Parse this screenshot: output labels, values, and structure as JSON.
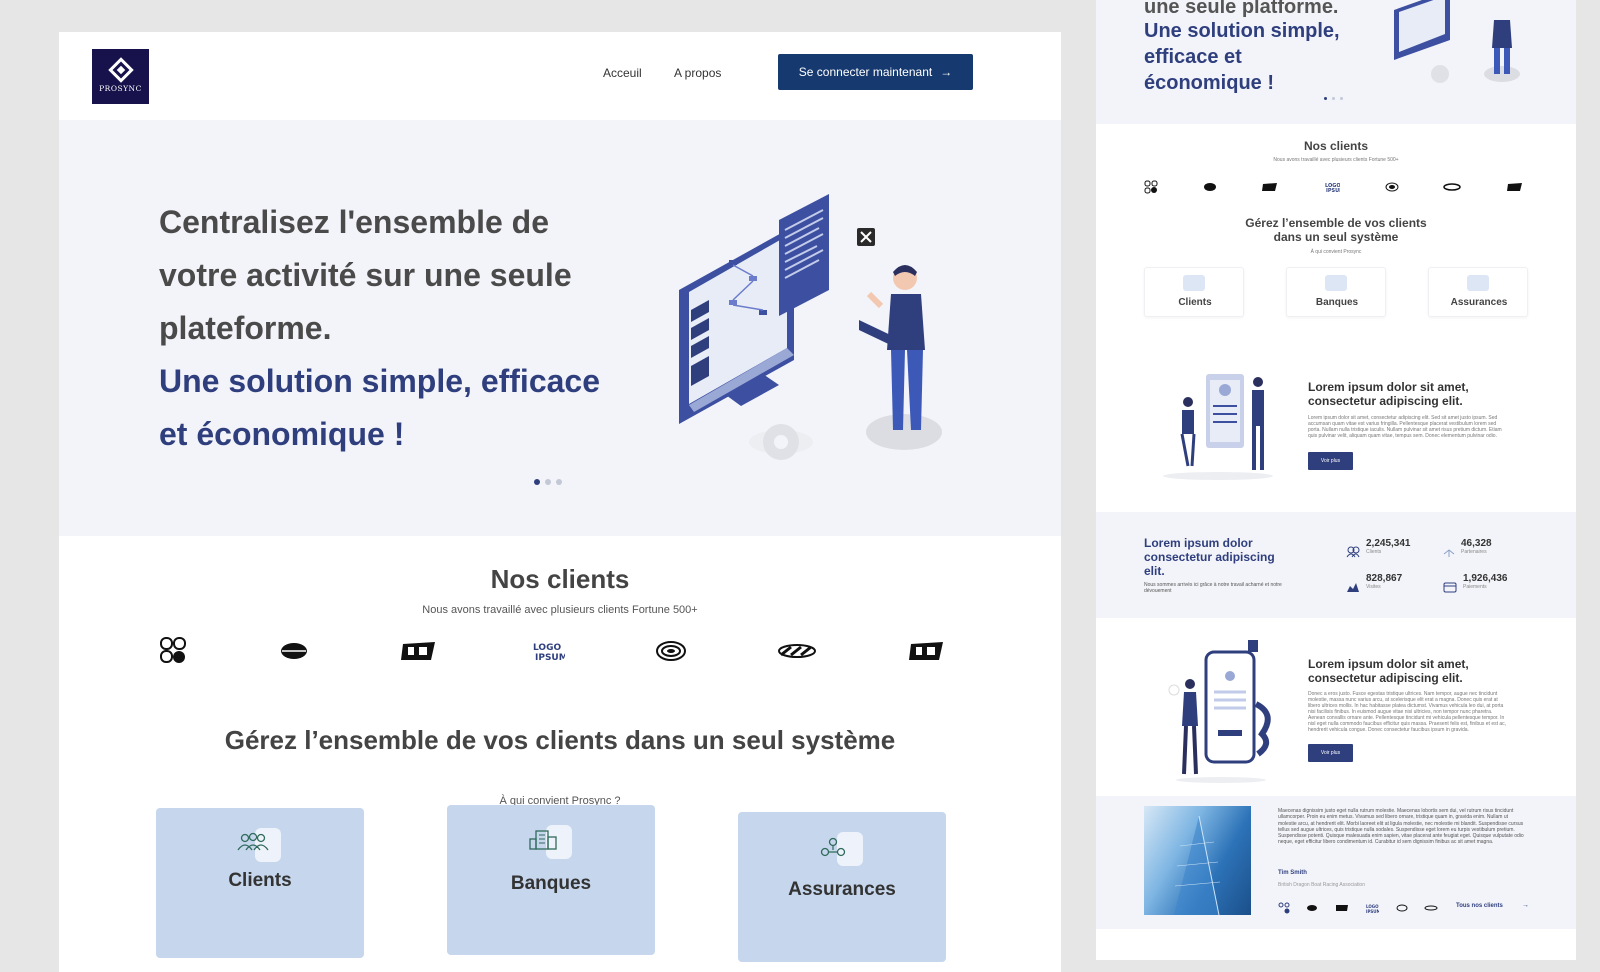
{
  "brand": {
    "logo_text": "PROSYNC"
  },
  "nav": {
    "home": "Acceuil",
    "about": "A propos",
    "cta": "Se connecter maintenant",
    "cta_arrow": "→"
  },
  "hero": {
    "line1": "Centralisez l'ensemble de votre activité sur une seule plateforme.",
    "line2": "Une solution simple, efficace et économique !",
    "slides_total": 3,
    "slide_active": 1
  },
  "clients": {
    "title": "Nos clients",
    "subtitle": "Nous avons travaillé avec plusieurs clients Fortune 500+"
  },
  "manage": {
    "title": "Gérez l’ensemble de vos clients dans un seul système",
    "subtitle": "À qui convient Prosync ?"
  },
  "cards": [
    {
      "label": "Clients",
      "icon": "people-icon"
    },
    {
      "label": "Banques",
      "icon": "bank-icon"
    },
    {
      "label": "Assurances",
      "icon": "insurance-icon"
    }
  ],
  "side": {
    "hero_top": "une seule platforme.",
    "hero_text": "Une solution simple, efficace et économique !",
    "clients_title": "Nos clients",
    "clients_subtitle": "Nous avons travaillé avec plusieurs clients Fortune 500+",
    "manage_title": "Gérez l’ensemble de vos clients dans un seul système",
    "manage_subtitle": "À qui convient Prosync",
    "feature1": {
      "title": "Lorem ipsum dolor sit amet, consectetur adipiscing elit.",
      "body": "Lorem ipsum dolor sit amet, consectetur adipiscing elit. Sed sit amet justo ipsum. Sed accumsan quam vitae est varius fringilla. Pellentesque placerat vestibulum lorem sed porta. Nullam nulla tristique iaculis. Nullam pulvinar sit amet risus pretium dictum. Etiam quis pulvinar velit, aliquam quam vitae, tempus sem. Donec elementum pulvinar odio.",
      "button": "Voir plus"
    },
    "stats_title": "Lorem ipsum dolor consectetur adipiscing elit.",
    "stats_body": "Nous sommes arrivés ici grâce à notre travail acharné et notre dévouement",
    "stats": [
      {
        "value": "2,245,341",
        "label": "Clients",
        "icon": "people-icon"
      },
      {
        "value": "46,328",
        "label": "Partenaires",
        "icon": "handshake-icon"
      },
      {
        "value": "828,867",
        "label": "Visites",
        "icon": "visits-icon"
      },
      {
        "value": "1,926,436",
        "label": "Paiements",
        "icon": "card-icon"
      }
    ],
    "feature2": {
      "title": "Lorem ipsum dolor sit amet, consectetur adipiscing elit.",
      "body": "Donec a eros justo. Fusce egestas tristique ultrices. Nam tempor, augue nec tincidunt molestie, massa nunc varius arcu, at scelerisque elit erat a magna. Donec quis erat at libero ultrices mollis. In hac habitasse platea dictumst. Vivamus vehicula leo dui, at porta nisi facilisis finibus. In euismod augue vitae nisi ultricies, non tempor nunc pharetra. Aenean convallis ornare ante. Pellentesque tincidunt mi vehicula pellentesque tempor. In nisl eget nulla commodo faucibus efficitur quis massa. Praesent felis est, finibus et est ac, hendrerit vehicula congue. Donec consectetur faucibus ipsum in gravida.",
      "button": "Voir plus"
    },
    "testimonial": {
      "quote": "Maecenas dignissim justo eget nulla rutrum molestie. Maecenas lobortis sem dui, vel rutrum risus tincidunt ullamcorper. Proin eu enim metus. Vivamus sed libero ornare, tristique quam in, gravida enim. Nullam ut molestie arcu, at hendrerit elit. Morbi laoreet elit at ligula molestie, nec molestie mi blandit. Suspendisse cursus tellus sed augue ultrices, quis tristique nulla sodales. Suspendisse eget lorem eu turpis vestibulum pretium. Suspendisse potenti. Quisque malesuada enim sapien, vitae placerat ante feugiat eget. Quisque vulputate odio neque, eget efficitur libero condimentum id. Curabitur id sem dignissim finibus ac sit amet magna.",
      "author": "Tim Smith",
      "org": "British Dragon Boat Racing Association",
      "all_clients": "Tous nos clients",
      "arrow": "→"
    }
  },
  "colors": {
    "navy": "#2f3f7e",
    "cta": "#163a70",
    "hero_bg": "#f3f4f9",
    "card_bg": "#c5d6ed",
    "logo_bg": "#17124b"
  }
}
